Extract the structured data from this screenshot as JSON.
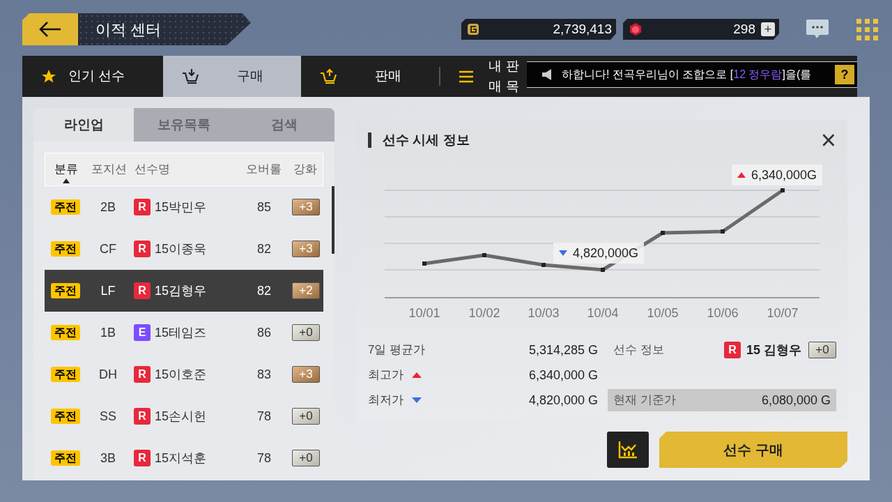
{
  "header": {
    "title": "이적 센터"
  },
  "currencies": [
    {
      "kind": "gold",
      "amount": "2,739,413"
    },
    {
      "kind": "gem",
      "amount": "298",
      "plus": "+"
    }
  ],
  "tabs": [
    {
      "label": "인기 선수",
      "kind": "star",
      "selected": false
    },
    {
      "label": "구매",
      "kind": "cart-in",
      "selected": true
    },
    {
      "label": "판매",
      "kind": "cart-out",
      "selected": false
    },
    {
      "label": "내 판매 목",
      "kind": "list",
      "selected": false
    }
  ],
  "ticker": {
    "before": "하합니다! 전곡우리님이 조합으로 [",
    "highlight": "12 정우람",
    "after": "]을(를",
    "help": "?"
  },
  "list_tabs": [
    {
      "label": "라인업",
      "selected": true
    },
    {
      "label": "보유목록",
      "selected": false
    },
    {
      "label": "검색",
      "selected": false
    }
  ],
  "columns": [
    {
      "label": "분류",
      "sorted": true
    },
    {
      "label": "포지션",
      "sorted": false
    },
    {
      "label": "선수명",
      "sorted": false
    },
    {
      "label": "오버롤",
      "sorted": false
    },
    {
      "label": "강화",
      "sorted": false
    }
  ],
  "players": [
    {
      "role": "주전",
      "position": "2B",
      "grade": "R",
      "color": "#e8283c",
      "name": "15박민우",
      "overall": "85",
      "enhance": {
        "text": "+3",
        "kind": "bronze"
      },
      "selected": false
    },
    {
      "role": "주전",
      "position": "CF",
      "grade": "R",
      "color": "#e8283c",
      "name": "15이종욱",
      "overall": "82",
      "enhance": {
        "text": "+3",
        "kind": "bronze"
      },
      "selected": false
    },
    {
      "role": "주전",
      "position": "LF",
      "grade": "R",
      "color": "#e8283c",
      "name": "15김형우",
      "overall": "82",
      "enhance": {
        "text": "+2",
        "kind": "bronze"
      },
      "selected": true
    },
    {
      "role": "주전",
      "position": "1B",
      "grade": "E",
      "color": "#7b4dff",
      "name": "15테임즈",
      "overall": "86",
      "enhance": {
        "text": "+0",
        "kind": "plain"
      },
      "selected": false
    },
    {
      "role": "주전",
      "position": "DH",
      "grade": "R",
      "color": "#e8283c",
      "name": "15이호준",
      "overall": "83",
      "enhance": {
        "text": "+3",
        "kind": "bronze"
      },
      "selected": false
    },
    {
      "role": "주전",
      "position": "SS",
      "grade": "R",
      "color": "#e8283c",
      "name": "15손시헌",
      "overall": "78",
      "enhance": {
        "text": "+0",
        "kind": "plain"
      },
      "selected": false
    },
    {
      "role": "주전",
      "position": "3B",
      "grade": "R",
      "color": "#e8283c",
      "name": "15지석훈",
      "overall": "78",
      "enhance": {
        "text": "+0",
        "kind": "plain"
      },
      "selected": false
    }
  ],
  "price_panel": {
    "title": "선수 시세 정보",
    "close": "×",
    "dates": [
      "10/01",
      "10/02",
      "10/03",
      "10/04",
      "10/05",
      "10/06",
      "10/07"
    ],
    "high_callout": "6,340,000G",
    "low_callout": "4,820,000G",
    "stats": [
      {
        "label": "7일 평균가",
        "value": "5,314,285 G",
        "kind": "plain"
      },
      {
        "label": "최고가",
        "value": "6,340,000 G",
        "kind": "up"
      },
      {
        "label": "최저가",
        "value": "4,820,000 G",
        "kind": "down"
      }
    ],
    "player_info": {
      "label": "선수 정보",
      "grade": "R",
      "color": "#e8283c",
      "name": "15 김형우",
      "enhance": "+0"
    },
    "current": {
      "label": "현재 기준가",
      "value": "6,080,000 G"
    }
  },
  "buy_button": "선수 구매"
}
